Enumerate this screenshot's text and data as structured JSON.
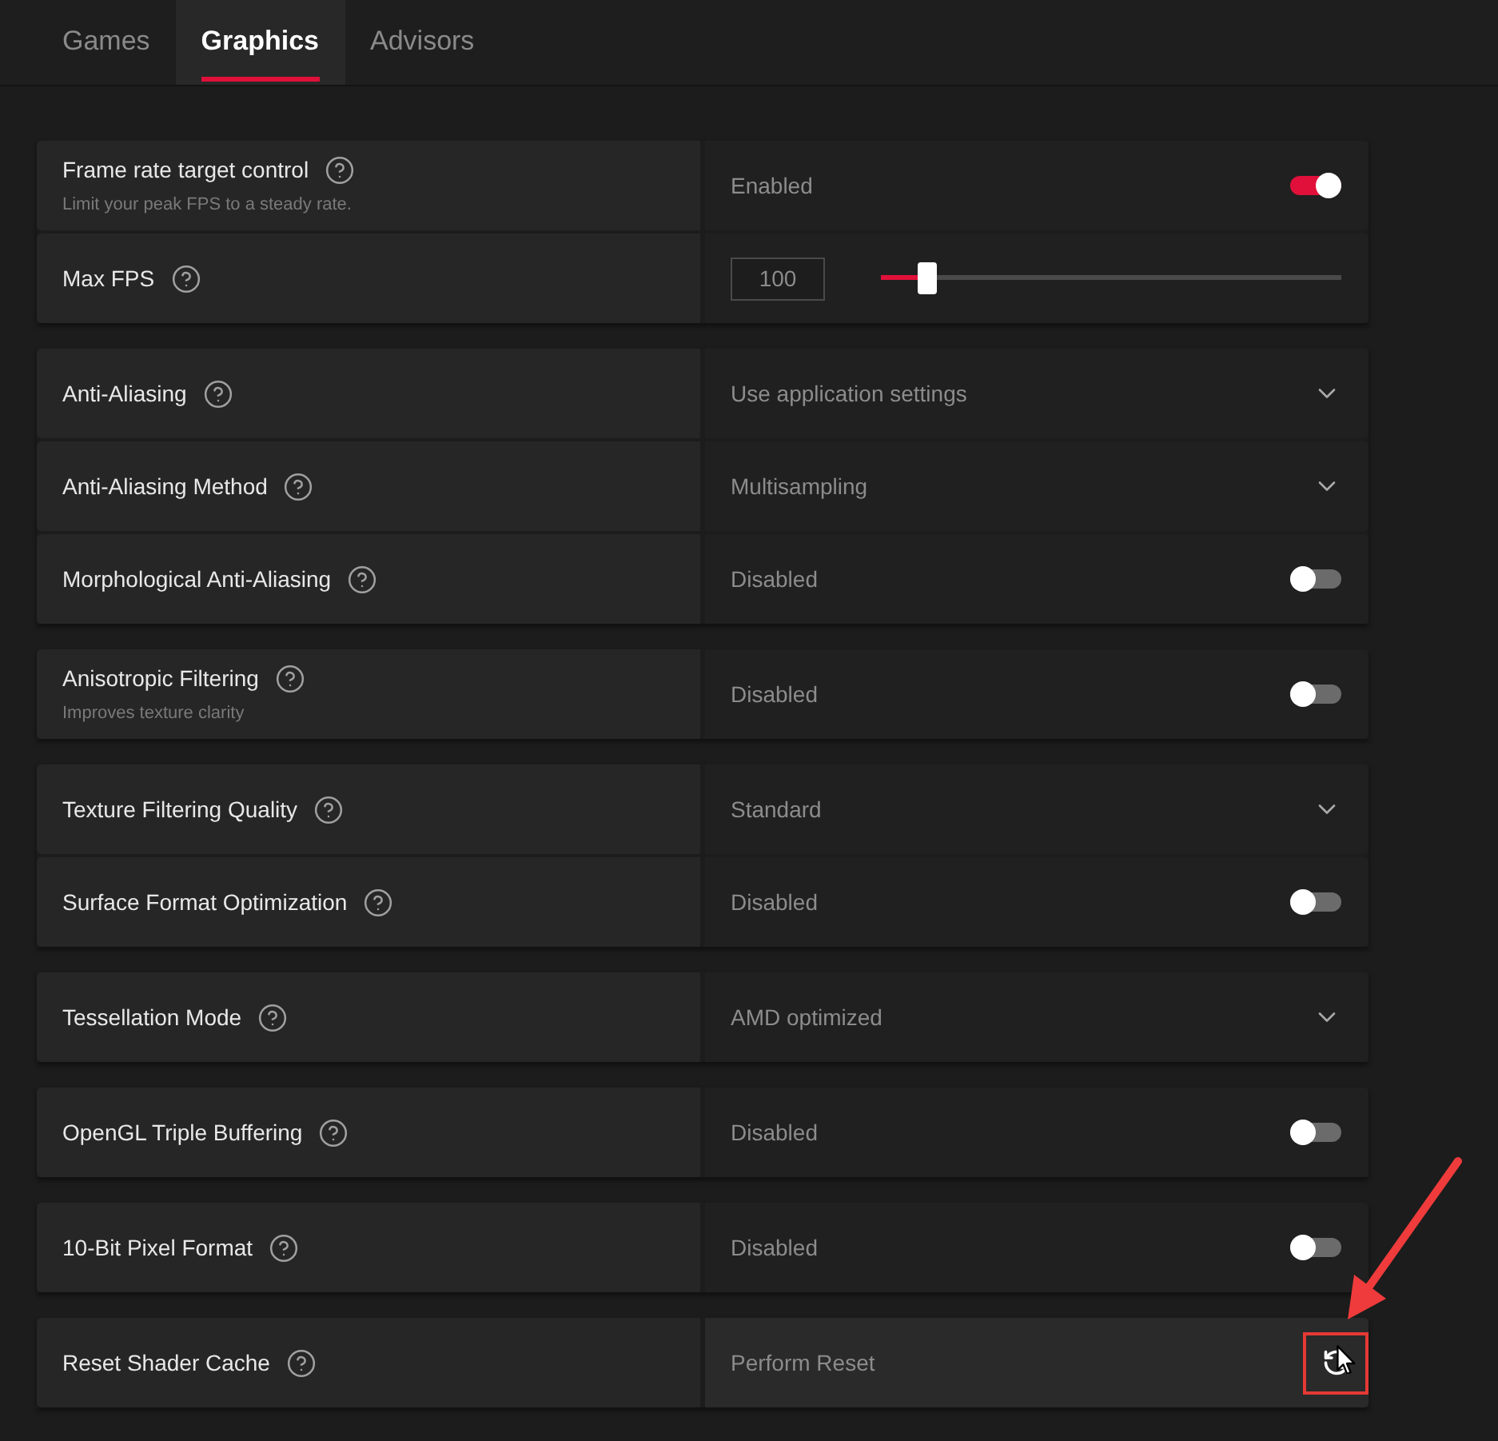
{
  "tabs": [
    {
      "label": "Games",
      "selected": false
    },
    {
      "label": "Graphics",
      "selected": true
    },
    {
      "label": "Advisors",
      "selected": false
    }
  ],
  "groups": [
    {
      "rows": [
        {
          "kind": "toggle",
          "label": "Frame rate target control",
          "description": "Limit your peak FPS to a steady rate.",
          "value": "Enabled",
          "on": true
        },
        {
          "kind": "slider",
          "label": "Max FPS",
          "input": "100",
          "level": 0.1
        }
      ]
    },
    {
      "rows": [
        {
          "kind": "dropdown",
          "label": "Anti-Aliasing",
          "value": "Use application settings"
        },
        {
          "kind": "dropdown",
          "label": "Anti-Aliasing Method",
          "value": "Multisampling"
        },
        {
          "kind": "toggle",
          "label": "Morphological Anti-Aliasing",
          "value": "Disabled",
          "on": false
        }
      ]
    },
    {
      "rows": [
        {
          "kind": "toggle",
          "label": "Anisotropic Filtering",
          "description": "Improves texture clarity",
          "value": "Disabled",
          "on": false
        }
      ]
    },
    {
      "rows": [
        {
          "kind": "dropdown",
          "label": "Texture Filtering Quality",
          "value": "Standard"
        },
        {
          "kind": "toggle",
          "label": "Surface Format Optimization",
          "value": "Disabled",
          "on": false
        }
      ]
    },
    {
      "rows": [
        {
          "kind": "dropdown",
          "label": "Tessellation Mode",
          "value": "AMD optimized"
        }
      ]
    },
    {
      "rows": [
        {
          "kind": "toggle",
          "label": "OpenGL Triple Buffering",
          "value": "Disabled",
          "on": false
        }
      ]
    },
    {
      "rows": [
        {
          "kind": "toggle",
          "label": "10-Bit Pixel Format",
          "value": "Disabled",
          "on": false
        }
      ]
    },
    {
      "rows": [
        {
          "kind": "button",
          "label": "Reset Shader Cache",
          "value": "Perform Reset",
          "hovered": true,
          "annotated": true
        }
      ]
    }
  ]
}
